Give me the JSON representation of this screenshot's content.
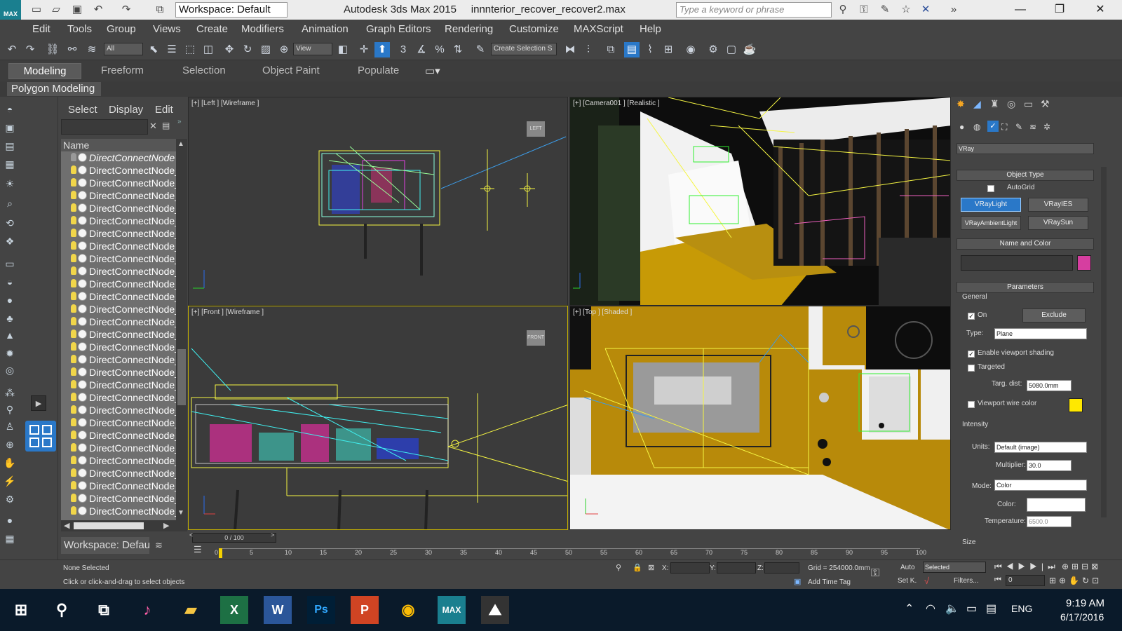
{
  "titlebar": {
    "workspace": "Workspace: Default",
    "app_title": "Autodesk 3ds Max  2015",
    "file_name": "innnterior_recover_recover2.max",
    "search_placeholder": "Type a keyword or phrase"
  },
  "menubar": [
    "Edit",
    "Tools",
    "Group",
    "Views",
    "Create",
    "Modifiers",
    "Animation",
    "Graph Editors",
    "Rendering",
    "Customize",
    "MAXScript",
    "Help"
  ],
  "toolbar": {
    "filter": "All",
    "view": "View",
    "selection_set": "Create Selection S"
  },
  "ribbon": {
    "tabs": [
      "Modeling",
      "Freeform",
      "Selection",
      "Object Paint",
      "Populate"
    ],
    "sub_tab": "Polygon Modeling"
  },
  "explorer": {
    "menu": [
      "Select",
      "Display",
      "Edit"
    ],
    "column": "Name",
    "items": [
      "DirectConnectNode",
      "DirectConnectNode_",
      "DirectConnectNode_",
      "DirectConnectNode_",
      "DirectConnectNode_",
      "DirectConnectNode_",
      "DirectConnectNode_",
      "DirectConnectNode_",
      "DirectConnectNode_",
      "DirectConnectNode_",
      "DirectConnectNode_",
      "DirectConnectNode_",
      "DirectConnectNode_",
      "DirectConnectNode_",
      "DirectConnectNode_",
      "DirectConnectNode_",
      "DirectConnectNode_",
      "DirectConnectNode_",
      "DirectConnectNode_",
      "DirectConnectNode_",
      "DirectConnectNode_",
      "DirectConnectNode_",
      "DirectConnectNode_",
      "DirectConnectNode_",
      "DirectConnectNode_",
      "DirectConnectNode_",
      "DirectConnectNode_",
      "DirectConnectNode_",
      "DirectConnectNode_"
    ],
    "footer": "Workspace: Defau"
  },
  "viewports": {
    "left": "[+] [Left ] [Wireframe ]",
    "camera": "[+] [Camera001 ] [Realistic ]",
    "front": "[+] [Front ] [Wireframe ]",
    "top": "[+] [Top ] [Shaded ]",
    "cube_left": "LEFT",
    "cube_front": "FRONT"
  },
  "command_panel": {
    "renderer": "VRay",
    "object_type": "Object Type",
    "autogrid": "AutoGrid",
    "buttons": [
      "VRayLight",
      "VRayIES",
      "VRayAmbientLight",
      "VRaySun"
    ],
    "name_and_color": "Name and Color",
    "parameters": "Parameters",
    "general": "General",
    "on": "On",
    "exclude": "Exclude",
    "type_label": "Type:",
    "type_value": "Plane",
    "enable_viewport_shading": "Enable viewport shading",
    "targeted": "Targeted",
    "targ_dist_label": "Targ. dist:",
    "targ_dist": "5080.0mm",
    "viewport_wire_color": "Viewport wire color",
    "intensity": "Intensity",
    "units_label": "Units:",
    "units": "Default (image)",
    "multiplier_label": "Multiplier:",
    "multiplier": "30.0",
    "mode_label": "Mode:",
    "mode": "Color",
    "color_label": "Color:",
    "temperature_label": "Temperature:",
    "temperature": "6500.0",
    "size": "Size",
    "colors": {
      "swatch": "#d63ea0",
      "wire": "#ffe800",
      "color": "#ffffff"
    }
  },
  "timeline": {
    "frame": "0 / 100",
    "ticks": [
      "0",
      "5",
      "10",
      "15",
      "20",
      "25",
      "30",
      "35",
      "40",
      "45",
      "50",
      "55",
      "60",
      "65",
      "70",
      "75",
      "80",
      "85",
      "90",
      "95",
      "100"
    ]
  },
  "status": {
    "none_selected": "None Selected",
    "prompt": "Click or click-and-drag to select objects",
    "x": "X:",
    "y": "Y:",
    "z": "Z:",
    "grid": "Grid = 254000.0mm",
    "add_time_tag": "Add Time Tag",
    "auto": "Auto",
    "selected": "Selected",
    "set_k": "Set K.",
    "filters": "Filters...",
    "frame_field": "0"
  },
  "taskbar": {
    "lang": "ENG",
    "time": "9:19 AM",
    "date": "6/17/2016"
  }
}
